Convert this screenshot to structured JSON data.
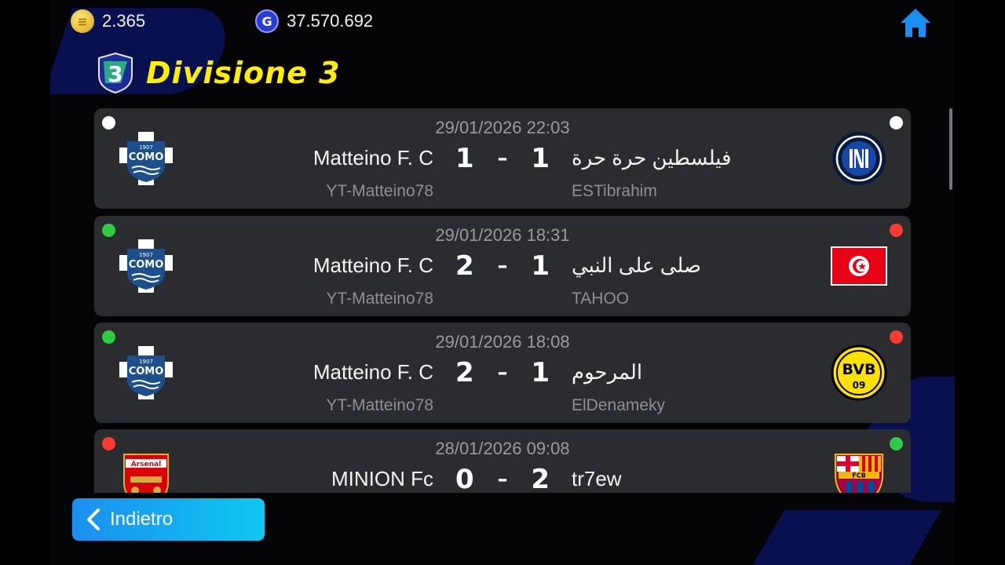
{
  "topbar": {
    "coins": {
      "icon": "gold-coin-icon",
      "value": "2.365"
    },
    "gp": {
      "icon": "gp-coin-icon",
      "value": "37.570.692"
    }
  },
  "header": {
    "badge_number": "3",
    "title": "Divisione 3"
  },
  "matches": [
    {
      "date": "29/01/2026 22:03",
      "home_team": "Matteino F. C",
      "home_user": "YT-Matteino78",
      "home_score": "1",
      "away_score": "1",
      "away_team": "فيلسطين  حرة حرة",
      "away_user": "ESTibrahim",
      "home_crest": "como-crest-icon",
      "away_crest": "inter-crest-icon",
      "left_dot": "#ffffff",
      "right_dot": "#ffffff"
    },
    {
      "date": "29/01/2026 18:31",
      "home_team": "Matteino F. C",
      "home_user": "YT-Matteino78",
      "home_score": "2",
      "away_score": "1",
      "away_team": "صلى على النبي",
      "away_user": "TAHOO",
      "home_crest": "como-crest-icon",
      "away_crest": "tunisia-flag-icon",
      "left_dot": "#2ecc40",
      "right_dot": "#ff3b30"
    },
    {
      "date": "29/01/2026 18:08",
      "home_team": "Matteino F. C",
      "home_user": "YT-Matteino78",
      "home_score": "2",
      "away_score": "1",
      "away_team": "المرحوم",
      "away_user": "ElDenameky",
      "home_crest": "como-crest-icon",
      "away_crest": "bvb-crest-icon",
      "left_dot": "#2ecc40",
      "right_dot": "#ff3b30"
    },
    {
      "date": "28/01/2026 09:08",
      "home_team": "MINION Fc",
      "home_user": "",
      "home_score": "0",
      "away_score": "2",
      "away_team": "tr7ew",
      "away_user": "",
      "home_crest": "arsenal-crest-icon",
      "away_crest": "barcelona-crest-icon",
      "left_dot": "#ff3b30",
      "right_dot": "#2ecc40"
    }
  ],
  "crest_text": {
    "como_year": "1907",
    "como_name": "COMO",
    "bvb_top": "BVB",
    "bvb_bottom": "09",
    "arsenal_name": "Arsenal",
    "fcb_name": "FCB"
  },
  "footer": {
    "back_label": "Indietro"
  },
  "colors": {
    "title_yellow": "#ffee00",
    "card_bg": "#2b2c30",
    "back_button_start": "#1b8ff0",
    "back_button_end": "#0fc8f0",
    "home_icon_blue": "#1a8ff0"
  }
}
